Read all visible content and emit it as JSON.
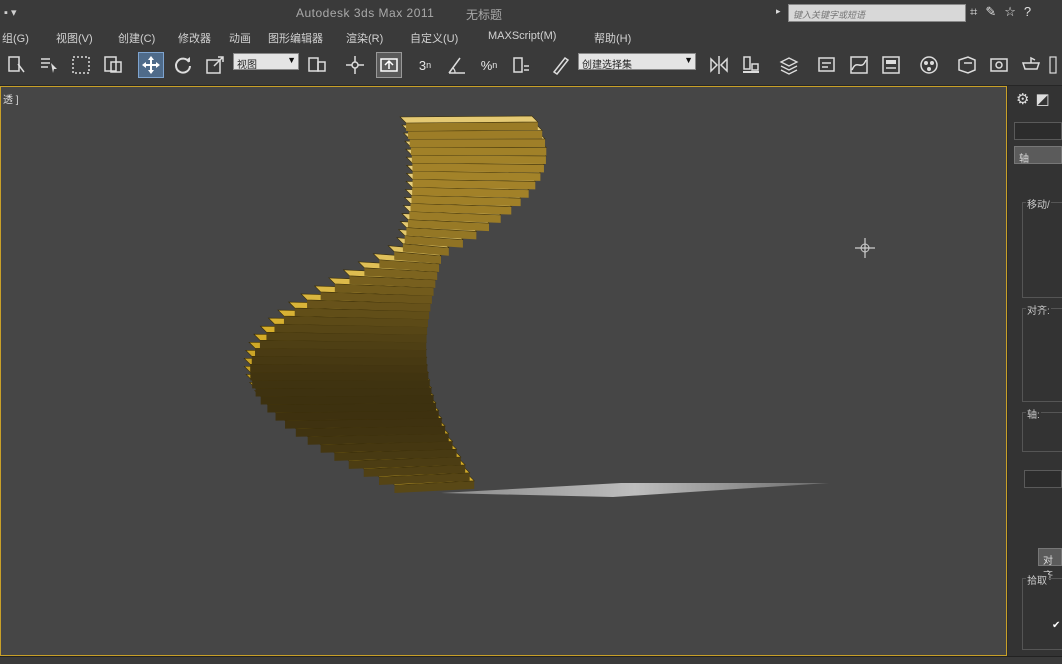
{
  "titlebar": {
    "quick_access": "▪ ▾",
    "app_title": "Autodesk 3ds Max  2011",
    "file_name": "无标题",
    "search_arrow": "▸",
    "search_placeholder": "键入关键字或短语",
    "right_icons": [
      "binoculars-icon",
      "help-tools-icon",
      "star-icon",
      "question-icon"
    ]
  },
  "menubar": {
    "items": [
      "组(G)",
      "视图(V)",
      "创建(C)",
      "修改器",
      "动画",
      "图形编辑器",
      "渲染(R)",
      "自定义(U)",
      "MAXScript(M)",
      "帮助(H)"
    ]
  },
  "toolbar": {
    "selection_filter": "视图",
    "named_selection": "创建选择集",
    "snap_numbers": [
      "3",
      "%"
    ]
  },
  "viewport": {
    "label": "透 ]",
    "background": "#464646",
    "stair_color": "#c9a62a"
  },
  "command_panel": {
    "button_1": "轴",
    "group_1": "移动/",
    "group_2": "对齐:",
    "group_3": "轴:",
    "group_4_btn": "对齐",
    "group_5": "拾取",
    "check_label": "✔"
  }
}
